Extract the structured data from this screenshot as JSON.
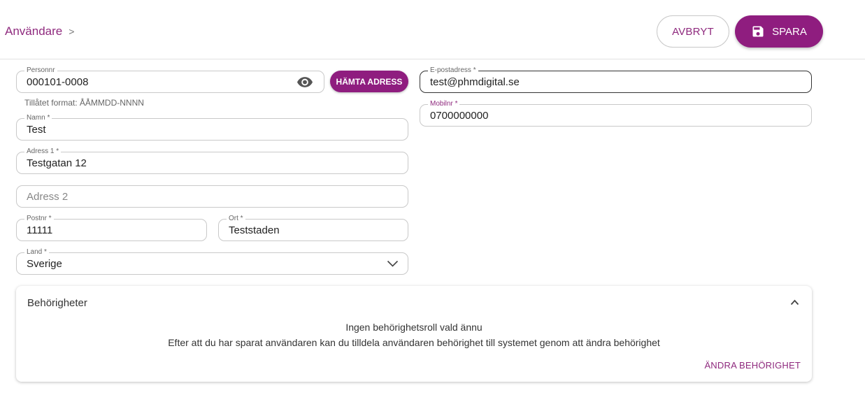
{
  "header": {
    "breadcrumb": "Användare",
    "breadcrumb_sep": ">",
    "cancel_label": "AVBRYT",
    "save_label": "SPARA"
  },
  "form": {
    "personnr": {
      "label": "Personnr",
      "value": "000101-0008",
      "helper": "Tillåtet format: ÅÅMMDD-NNNN"
    },
    "fetch_address_label": "HÄMTA ADRESS",
    "namn": {
      "label": "Namn *",
      "value": "Test"
    },
    "adress1": {
      "label": "Adress 1 *",
      "value": "Testgatan 12"
    },
    "adress2": {
      "placeholder": "Adress 2"
    },
    "postnr": {
      "label": "Postnr *",
      "value": "11111"
    },
    "ort": {
      "label": "Ort *",
      "value": "Teststaden"
    },
    "land": {
      "label": "Land *",
      "value": "Sverige"
    },
    "email": {
      "label": "E-postadress *",
      "value": "test@phmdigital.se"
    },
    "mobil": {
      "label": "Mobilnr *",
      "value": "0700000000"
    }
  },
  "permissions": {
    "title": "Behörigheter",
    "empty_message": "Ingen behörighetsroll vald ännu",
    "info_message": "Efter att du har sparat användaren kan du tilldela användaren behörighet till systemet genom att ändra behörighet",
    "change_label": "ÄNDRA BEHÖRIGHET"
  },
  "colors": {
    "accent": "#8f1d7f",
    "accent_text": "#8f2a7e"
  },
  "icons": {
    "save": "save-icon",
    "visibility": "eye-icon",
    "select": "chevron-down-icon",
    "collapse": "chevron-up-icon"
  }
}
